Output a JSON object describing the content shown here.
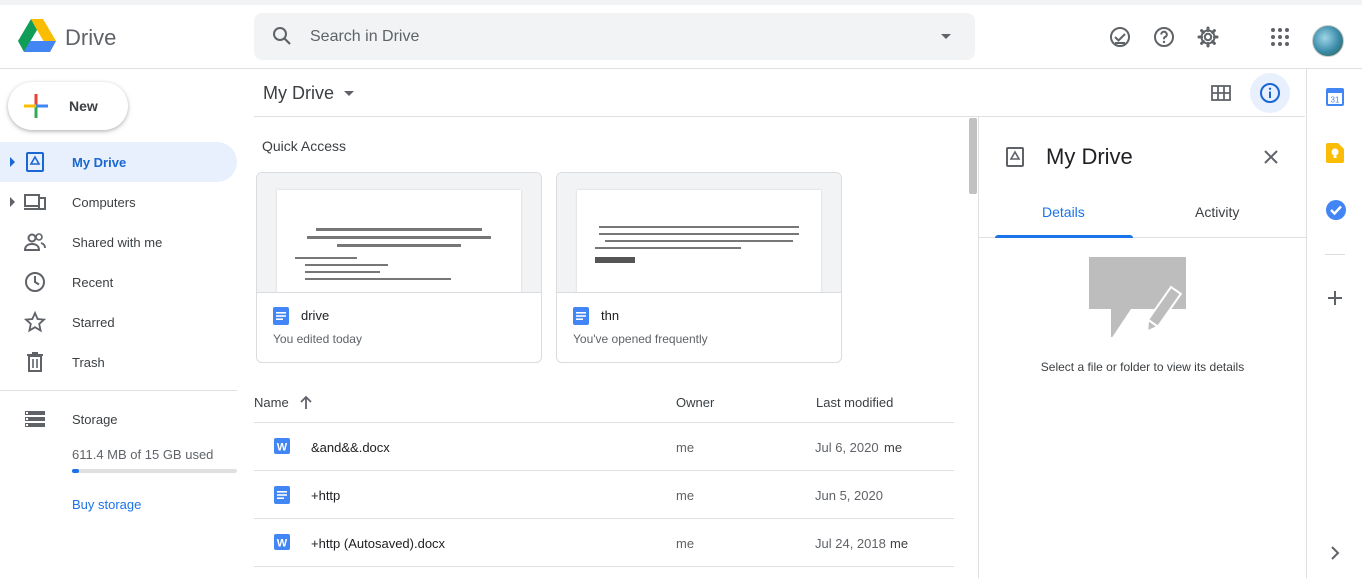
{
  "header": {
    "app_name": "Drive",
    "search_placeholder": "Search in Drive"
  },
  "sidebar": {
    "new_label": "New",
    "items": [
      {
        "label": "My Drive",
        "icon": "my-drive-icon",
        "active": true
      },
      {
        "label": "Computers",
        "icon": "computers-icon"
      },
      {
        "label": "Shared with me",
        "icon": "shared-icon"
      },
      {
        "label": "Recent",
        "icon": "clock-icon"
      },
      {
        "label": "Starred",
        "icon": "star-icon"
      },
      {
        "label": "Trash",
        "icon": "trash-icon"
      }
    ],
    "storage": {
      "label": "Storage",
      "used_text": "611.4 MB of 15 GB used",
      "used_fraction": 0.04,
      "buy_label": "Buy storage"
    }
  },
  "main": {
    "breadcrumb": "My Drive",
    "quick_access_title": "Quick Access",
    "quick_access": [
      {
        "name": "drive",
        "subtitle": "You edited today"
      },
      {
        "name": "thn",
        "subtitle": "You've opened frequently"
      }
    ],
    "columns": {
      "name": "Name",
      "owner": "Owner",
      "modified": "Last modified"
    },
    "files": [
      {
        "name": "&and&&.docx",
        "type": "word",
        "owner": "me",
        "modified": "Jul 6, 2020",
        "modified_by": "me"
      },
      {
        "name": "+http",
        "type": "doc",
        "owner": "me",
        "modified": "Jun 5, 2020",
        "modified_by": ""
      },
      {
        "name": "+http (Autosaved).docx",
        "type": "word",
        "owner": "me",
        "modified": "Jul 24, 2018",
        "modified_by": "me"
      }
    ]
  },
  "details": {
    "title": "My Drive",
    "tabs": [
      "Details",
      "Activity"
    ],
    "empty_text": "Select a file or folder to view its details"
  },
  "colors": {
    "accent": "#1a73e8",
    "active_bg": "#e8f0fe",
    "doc_blue": "#4285f4"
  }
}
